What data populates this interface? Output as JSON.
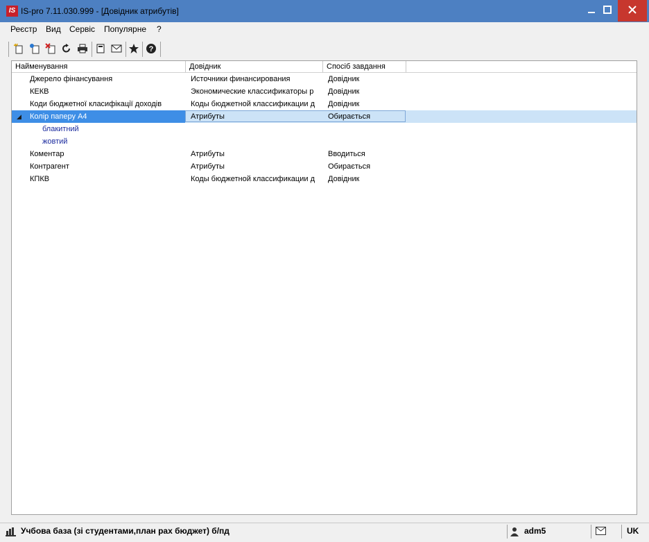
{
  "window": {
    "title": "IS-pro 7.11.030.999 - [Довідник атрибутів]",
    "app_icon_text": "IS"
  },
  "menu": [
    "Реєстр",
    "Вид",
    "Сервіс",
    "Популярне",
    "?"
  ],
  "toolbar": {
    "icons": [
      "new-icon",
      "copy-icon",
      "delete-icon",
      "refresh-icon",
      "print-icon",
      "document-icon",
      "mail-icon",
      "favorites-star-icon",
      "help-icon"
    ]
  },
  "table": {
    "columns": [
      "Найменування",
      "Довідник",
      "Спосіб завдання"
    ],
    "rows": [
      {
        "name": "Джерело фінансування",
        "ref": "Источники финансирования",
        "mode": "Довідник"
      },
      {
        "name": "КЕКВ",
        "ref": "Экономические классификаторы р",
        "mode": "Довідник"
      },
      {
        "name": "Коди бюджетної класифікації доходів",
        "ref": "Коды бюджетной классификации д",
        "mode": "Довідник"
      },
      {
        "name": "Колір паперу А4",
        "ref": "Атрибуты",
        "mode": "Обирається",
        "expander": "◢"
      },
      {
        "name": "блакитний",
        "ref": "",
        "mode": ""
      },
      {
        "name": "жовтий",
        "ref": "",
        "mode": ""
      },
      {
        "name": "Коментар",
        "ref": "Атрибуты",
        "mode": "Вводиться"
      },
      {
        "name": "Контрагент",
        "ref": "Атрибуты",
        "mode": "Обирається"
      },
      {
        "name": "КПКВ",
        "ref": "Коды бюджетной классификации д",
        "mode": "Довідник"
      }
    ]
  },
  "status": {
    "database": "Учбова база (зі студентами,план рах бюджет) б/пд",
    "user": "adm5",
    "language": "UK"
  }
}
